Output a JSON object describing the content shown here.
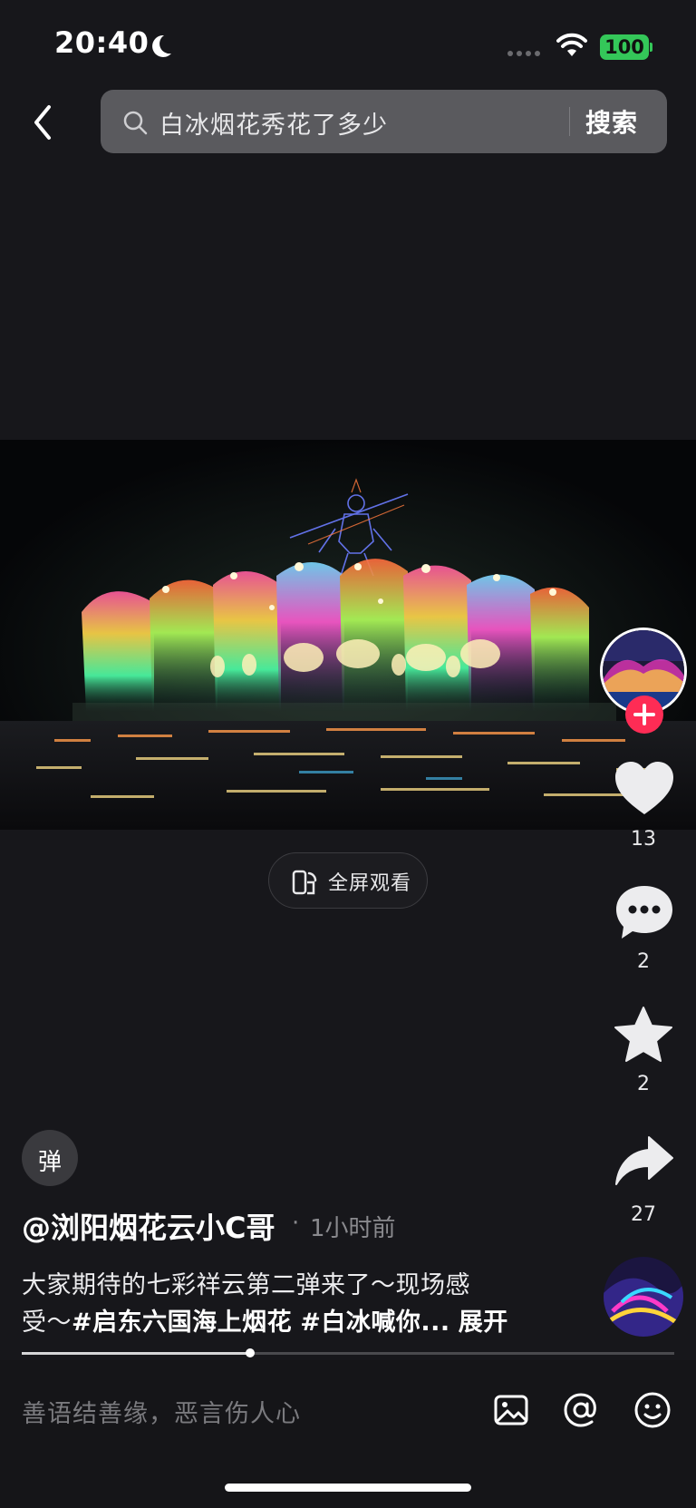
{
  "status_bar": {
    "time": "20:40",
    "battery": "100"
  },
  "header": {
    "search_query": "白冰烟花秀花了多少",
    "search_button": "搜索"
  },
  "video": {
    "fullscreen_label": "全屏观看"
  },
  "actions": {
    "likes": "13",
    "comments": "2",
    "favorites": "2",
    "shares": "27"
  },
  "danmaku_label": "弹",
  "post": {
    "author": "@浏阳烟花云小C哥",
    "separator": "·",
    "time_ago": "1小时前",
    "desc_line1": "大家期待的七彩祥云第二弹来了～现场感",
    "desc_line2_prefix": "受～",
    "tag1": "#启东六国海上烟花",
    "tag2": "#白冰喊你...",
    "expand": "展开"
  },
  "progress": 0.35,
  "comment_bar": {
    "placeholder": "善语结善缘，恶言伤人心"
  },
  "colors": {
    "accent": "#fe2c55",
    "battery": "#34c759",
    "background": "#17171b"
  }
}
